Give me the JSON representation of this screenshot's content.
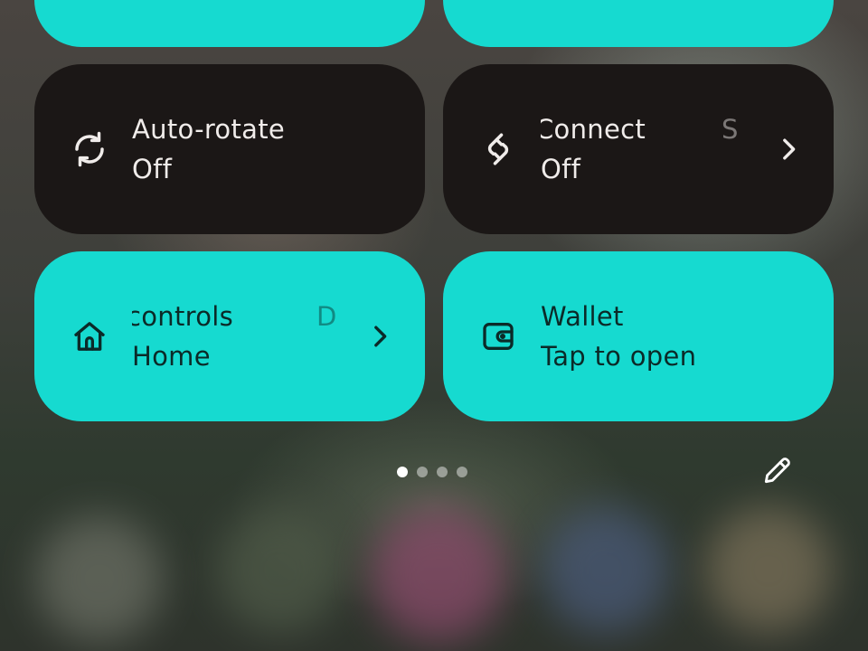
{
  "colors": {
    "tile_on": "#16dad0",
    "tile_off": "#1b1716",
    "text_on": "#0b2a28",
    "text_off": "#f0ecea"
  },
  "tiles": [
    {
      "id": "auto-rotate",
      "title": "Auto-rotate",
      "subtitle": "Off",
      "state": "off",
      "icon": "rotate-icon",
      "has_chevron": false
    },
    {
      "id": "connect",
      "title": "Connect",
      "title_trailing_clip": "S",
      "subtitle": "Off",
      "state": "off",
      "icon": "connect-icon",
      "has_chevron": true
    },
    {
      "id": "home-controls",
      "title": "controls",
      "title_trailing_clip": "D",
      "subtitle": "Home",
      "state": "on",
      "icon": "home-icon",
      "has_chevron": true
    },
    {
      "id": "wallet",
      "title": "Wallet",
      "subtitle": "Tap to open",
      "state": "on",
      "icon": "wallet-icon",
      "has_chevron": false
    }
  ],
  "pager": {
    "page_count": 4,
    "active_index": 0
  },
  "edit_icon": "pencil-icon"
}
